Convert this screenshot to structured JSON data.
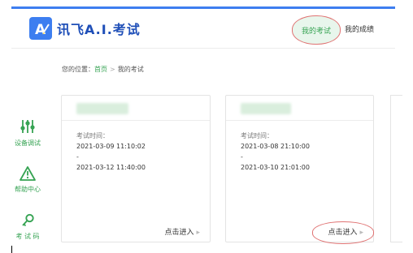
{
  "header": {
    "brand": "讯飞A.I.考试",
    "nav": [
      "我的考试",
      "我的成绩"
    ]
  },
  "breadcrumb": {
    "prefix": "您的位置：",
    "home": "首页",
    "separator": ">",
    "current": "我的考试"
  },
  "sidebar": [
    {
      "label": "设备调试",
      "icon": "sliders-icon"
    },
    {
      "label": "帮助中心",
      "icon": "warning-icon"
    },
    {
      "label": "考 试 码",
      "icon": "key-icon"
    }
  ],
  "exams": [
    {
      "time_label": "考试时间：",
      "start": "2021-03-09 11:10:02",
      "dash": "-",
      "end": "2021-03-12 11:40:00",
      "action": "点击进入"
    },
    {
      "time_label": "考试时间：",
      "start": "2021-03-08 21:10:00",
      "dash": "-",
      "end": "2021-03-10 21:01:00",
      "action": "点击进入"
    }
  ],
  "colors": {
    "accent": "#3d7ef0",
    "brand_green": "#36a353",
    "annotation_red": "#e07272"
  }
}
